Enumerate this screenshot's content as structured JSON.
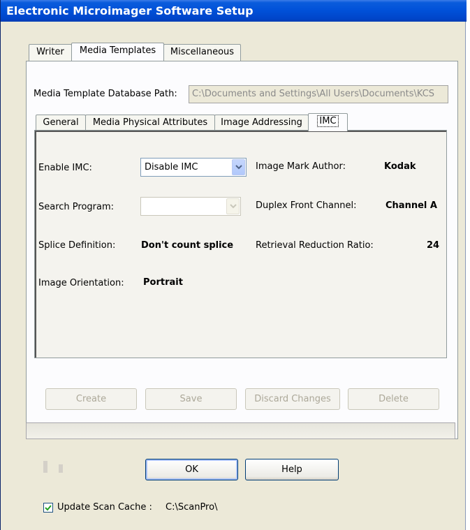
{
  "window": {
    "title": "Electronic Microimager Software Setup"
  },
  "main_tabs": [
    {
      "label": "Writer"
    },
    {
      "label": "Media Templates"
    },
    {
      "label": "Miscellaneous"
    }
  ],
  "db_path": {
    "label": "Media Template Database Path:",
    "value": "C:\\Documents and Settings\\All Users\\Documents\\KCS"
  },
  "sub_tabs": [
    {
      "label": "General"
    },
    {
      "label": "Media Physical Attributes"
    },
    {
      "label": "Image Addressing"
    },
    {
      "label": "IMC"
    }
  ],
  "imc": {
    "enable_label": "Enable IMC:",
    "enable_value": "Disable IMC",
    "search_label": "Search Program:",
    "search_value": "",
    "splice_label": "Splice Definition:",
    "splice_value": "Don't count splice",
    "orientation_label": "Image Orientation:",
    "orientation_value": "Portrait",
    "author_label": "Image Mark Author:",
    "author_value": "Kodak",
    "duplex_label": "Duplex Front Channel:",
    "duplex_value": "Channel A",
    "ratio_label": "Retrieval Reduction Ratio:",
    "ratio_value": "24"
  },
  "template_buttons": {
    "create": "Create",
    "save": "Save",
    "discard": "Discard Changes",
    "delete": "Delete"
  },
  "dialog_buttons": {
    "ok": "OK",
    "help": "Help"
  },
  "scan_cache": {
    "checked": true,
    "label": "Update Scan Cache :",
    "path": "C:\\ScanPro\\"
  }
}
